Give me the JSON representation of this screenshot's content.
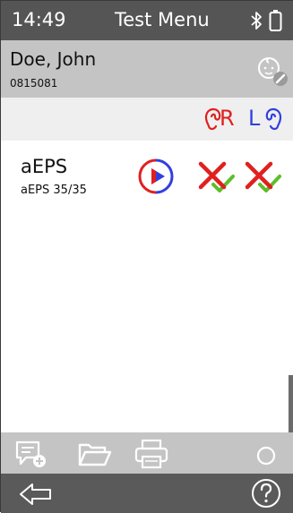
{
  "status_bar": {
    "time": "14:49",
    "title": "Test Menu",
    "icons": [
      "bluetooth-icon",
      "battery-icon"
    ]
  },
  "patient": {
    "name": "Doe, John",
    "id": "0815081",
    "icon": "baby-profile-icon"
  },
  "ears": {
    "right_label": "R",
    "left_label": "L",
    "right_color": "#e02020",
    "left_color": "#3040e0"
  },
  "tests": [
    {
      "name": "aEPS",
      "detail": "aEPS 35/35",
      "icons": [
        "play-icon",
        "result-fail-pass-icon",
        "result-fail-pass-icon"
      ]
    }
  ],
  "toolbar": {
    "icons": [
      "add-comment-icon",
      "folder-icon",
      "printer-icon",
      "circle-icon"
    ]
  },
  "navbar": {
    "icons": [
      "back-arrow-icon",
      "help-icon"
    ]
  },
  "colors": {
    "status_bg": "#555555",
    "header_bg": "#c4c4c4",
    "ear_row_bg": "#efefef",
    "nav_bg": "#5a5a5a",
    "red": "#e02020",
    "blue": "#3040e0",
    "green": "#5cbf2a"
  }
}
